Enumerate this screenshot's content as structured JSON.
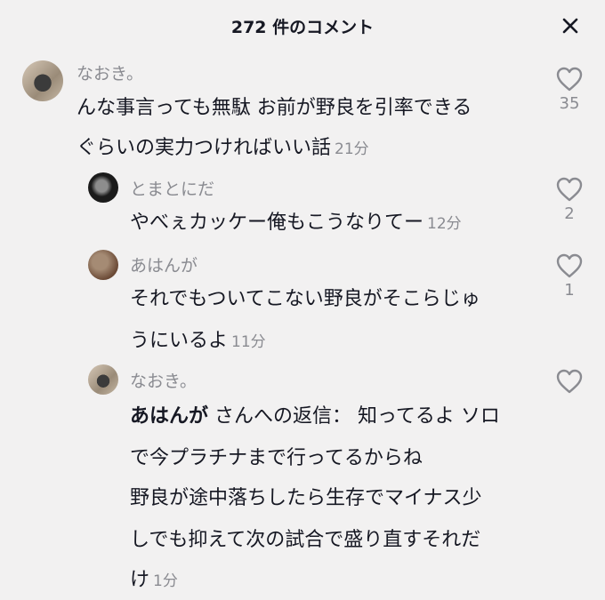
{
  "header": {
    "title": "272 件のコメント"
  },
  "comments": [
    {
      "username": "なおき。",
      "lines": [
        "んな事言っても無駄 お前が野良を引率できる",
        "ぐらいの実力つければいい話"
      ],
      "time": "21分",
      "likes": "35"
    },
    {
      "username": "とまとにだ",
      "lines": [
        "やべぇカッケー俺もこうなりてー"
      ],
      "time": "12分",
      "likes": "2"
    },
    {
      "username": "あはんが",
      "lines": [
        "それでもついてこない野良がそこらじゅ",
        "うにいるよ"
      ],
      "time": "11分",
      "likes": "1"
    },
    {
      "username": "なおき。",
      "reply_to": "あはんが",
      "reply_suffix": "さんへの返信：",
      "lines": [
        "知ってるよ ソロ",
        "で今プラチナまで行ってるからね",
        "野良が途中落ちしたら生存でマイナス少",
        "しでも抑えて次の試合で盛り直すそれだ",
        "け"
      ],
      "time": "1分",
      "likes": ""
    }
  ]
}
